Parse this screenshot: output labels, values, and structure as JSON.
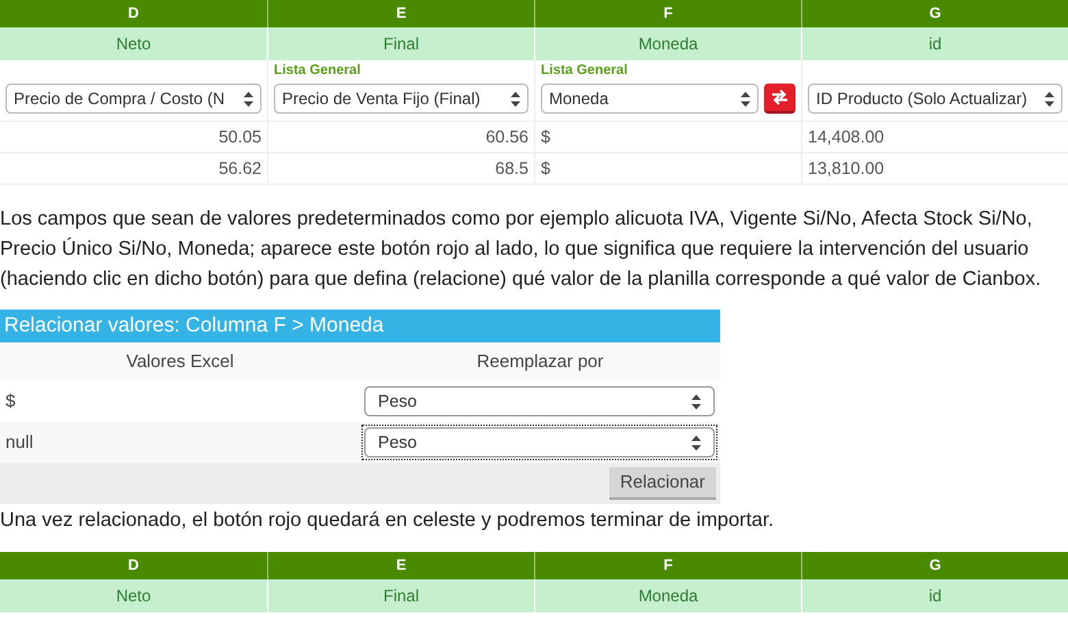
{
  "top_table": {
    "columns": [
      {
        "letter": "D",
        "field": "Neto",
        "mapping": "Precio de Compra / Costo (N",
        "relate_button": false
      },
      {
        "letter": "E",
        "field": "Final",
        "list_label": "Lista General",
        "mapping": "Precio de Venta Fijo (Final)",
        "relate_button": false
      },
      {
        "letter": "F",
        "field": "Moneda",
        "list_label": "Lista General",
        "mapping": "Moneda",
        "relate_button": true
      },
      {
        "letter": "G",
        "field": "id",
        "mapping": "ID Producto (Solo Actualizar)",
        "relate_button": false
      }
    ],
    "rows": [
      [
        "50.05",
        "60.56",
        "$",
        "14,408.00"
      ],
      [
        "56.62",
        "68.5",
        "$",
        "13,810.00"
      ]
    ]
  },
  "paragraph_1": "Los campos que sean de valores predeterminados como por ejemplo alicuota IVA, Vigente Si/No, Afecta Stock Si/No, Precio Único Si/No, Moneda; aparece este botón rojo al lado, lo que significa que requiere la intervención del usuario (haciendo clic en dicho botón) para que defina (relacione) qué valor de la planilla corresponde a qué valor de Cianbox.",
  "dialog": {
    "title": "Relacionar valores: Columna F > Moneda",
    "columns": [
      "Valores Excel",
      "Reemplazar por"
    ],
    "rows": [
      {
        "excel_value": "$",
        "replacement": "Peso",
        "focused": false
      },
      {
        "excel_value": "null",
        "replacement": "Peso",
        "focused": true
      }
    ],
    "button": "Relacionar"
  },
  "paragraph_2": "Una vez relacionado, el botón rojo quedará en celeste y podremos terminar de importar.",
  "bottom_table": {
    "columns": [
      {
        "letter": "D",
        "field": "Neto"
      },
      {
        "letter": "E",
        "field": "Final"
      },
      {
        "letter": "F",
        "field": "Moneda"
      },
      {
        "letter": "G",
        "field": "id"
      }
    ]
  }
}
